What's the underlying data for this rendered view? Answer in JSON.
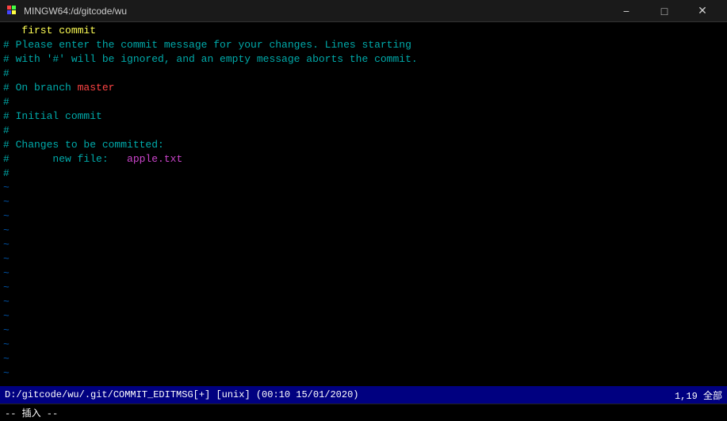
{
  "titleBar": {
    "title": "MINGW64:/d/gitcode/wu",
    "minimizeLabel": "−",
    "maximizeLabel": "□",
    "closeLabel": "✕"
  },
  "editor": {
    "lines": [
      {
        "type": "first-commit",
        "content": "   first commit"
      },
      {
        "type": "comment",
        "content": "# Please enter the commit message for your changes. Lines starting"
      },
      {
        "type": "comment",
        "content": "# with '#' will be ignored, and an empty message aborts the commit."
      },
      {
        "type": "comment-empty",
        "content": "#"
      },
      {
        "type": "comment-branch",
        "content": "# On branch ",
        "branch": "master"
      },
      {
        "type": "comment-empty",
        "content": "#"
      },
      {
        "type": "comment",
        "content": "# Initial commit"
      },
      {
        "type": "comment-empty",
        "content": "#"
      },
      {
        "type": "comment",
        "content": "# Changes to be committed:"
      },
      {
        "type": "comment-newfile",
        "content": "#       new file:   ",
        "filename": "apple.txt"
      },
      {
        "type": "comment-empty",
        "content": "#"
      },
      {
        "type": "tilde",
        "content": "~"
      },
      {
        "type": "tilde",
        "content": "~"
      },
      {
        "type": "tilde",
        "content": "~"
      },
      {
        "type": "tilde",
        "content": "~"
      },
      {
        "type": "tilde",
        "content": "~"
      },
      {
        "type": "tilde",
        "content": "~"
      },
      {
        "type": "tilde",
        "content": "~"
      },
      {
        "type": "tilde",
        "content": "~"
      },
      {
        "type": "tilde",
        "content": "~"
      },
      {
        "type": "tilde",
        "content": "~"
      },
      {
        "type": "tilde",
        "content": "~"
      },
      {
        "type": "tilde",
        "content": "~"
      },
      {
        "type": "tilde",
        "content": "~"
      },
      {
        "type": "tilde",
        "content": "~"
      },
      {
        "type": "tilde",
        "content": "~"
      },
      {
        "type": "tilde",
        "content": "~"
      },
      {
        "type": "tilde",
        "content": "~"
      }
    ]
  },
  "statusBar": {
    "left": "D:/gitcode/wu/.git/COMMIT_EDITMSG[+]  [unix]  (00:10 15/01/2020)",
    "right": "1,19  全部"
  },
  "modeBar": {
    "text": "-- 插入 --"
  }
}
